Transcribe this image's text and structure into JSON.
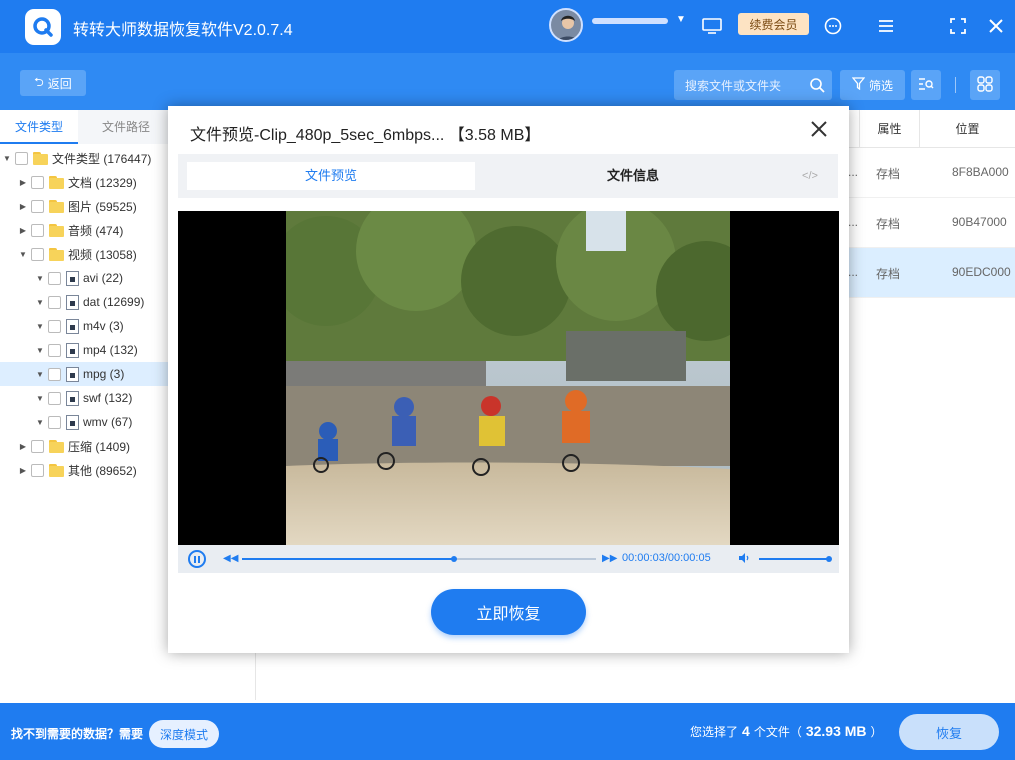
{
  "app": {
    "title": "转转大师数据恢复软件V2.0.7.4",
    "vip_label": "续费会员"
  },
  "toolbar": {
    "back_label": "返回",
    "search_placeholder": "搜索文件或文件夹",
    "filter_label": "筛选"
  },
  "left_panel": {
    "tabs": [
      "文件类型",
      "文件路径"
    ],
    "tree": [
      {
        "label": "文件类型 (176447)",
        "level": 0,
        "expanded": true,
        "kind": "folder"
      },
      {
        "label": "文档 (12329)",
        "level": 1,
        "expanded": false,
        "kind": "folder"
      },
      {
        "label": "图片 (59525)",
        "level": 1,
        "expanded": false,
        "kind": "folder"
      },
      {
        "label": "音频 (474)",
        "level": 1,
        "expanded": false,
        "kind": "folder"
      },
      {
        "label": "视频 (13058)",
        "level": 1,
        "expanded": true,
        "kind": "folder"
      },
      {
        "label": "avi (22)",
        "level": 2,
        "expanded": true,
        "kind": "file"
      },
      {
        "label": "dat (12699)",
        "level": 2,
        "expanded": true,
        "kind": "file"
      },
      {
        "label": "m4v (3)",
        "level": 2,
        "expanded": true,
        "kind": "file"
      },
      {
        "label": "mp4 (132)",
        "level": 2,
        "expanded": true,
        "kind": "file"
      },
      {
        "label": "mpg (3)",
        "level": 2,
        "expanded": true,
        "kind": "file",
        "selected": true
      },
      {
        "label": "swf (132)",
        "level": 2,
        "expanded": true,
        "kind": "file"
      },
      {
        "label": "wmv (67)",
        "level": 2,
        "expanded": true,
        "kind": "file"
      },
      {
        "label": "压缩 (1409)",
        "level": 1,
        "expanded": false,
        "kind": "folder"
      },
      {
        "label": "其他 (89652)",
        "level": 1,
        "expanded": false,
        "kind": "folder"
      }
    ]
  },
  "table": {
    "headers": {
      "attr": "属性",
      "location": "位置"
    },
    "rows": [
      {
        "ellipsis": "...",
        "attr": "存档",
        "location": "8F8BA000"
      },
      {
        "ellipsis": "...",
        "attr": "存档",
        "location": "90B47000"
      },
      {
        "ellipsis": "...",
        "attr": "存档",
        "location": "90EDC000",
        "selected": true
      }
    ]
  },
  "modal": {
    "title": "文件预览-Clip_480p_5sec_6mbps... 【3.58 MB】",
    "tabs": {
      "preview": "文件预览",
      "info": "文件信息",
      "code": "</>"
    },
    "player": {
      "time": "00:00:03/00:00:05",
      "progress": 0.6,
      "volume": 1.0
    },
    "restore_button": "立即恢复"
  },
  "footer": {
    "question": "找不到需要的数据？需要",
    "deep_mode": "深度模式",
    "selected_prefix": "您选择了",
    "selected_count": "4",
    "selected_mid": "个文件（",
    "selected_size": "32.93 MB",
    "selected_suffix": "）",
    "recover_label": "恢复"
  },
  "colors": {
    "primary": "#1f7cf0",
    "toolbar": "#2f8af3",
    "vip_bg": "#fde3c3"
  }
}
